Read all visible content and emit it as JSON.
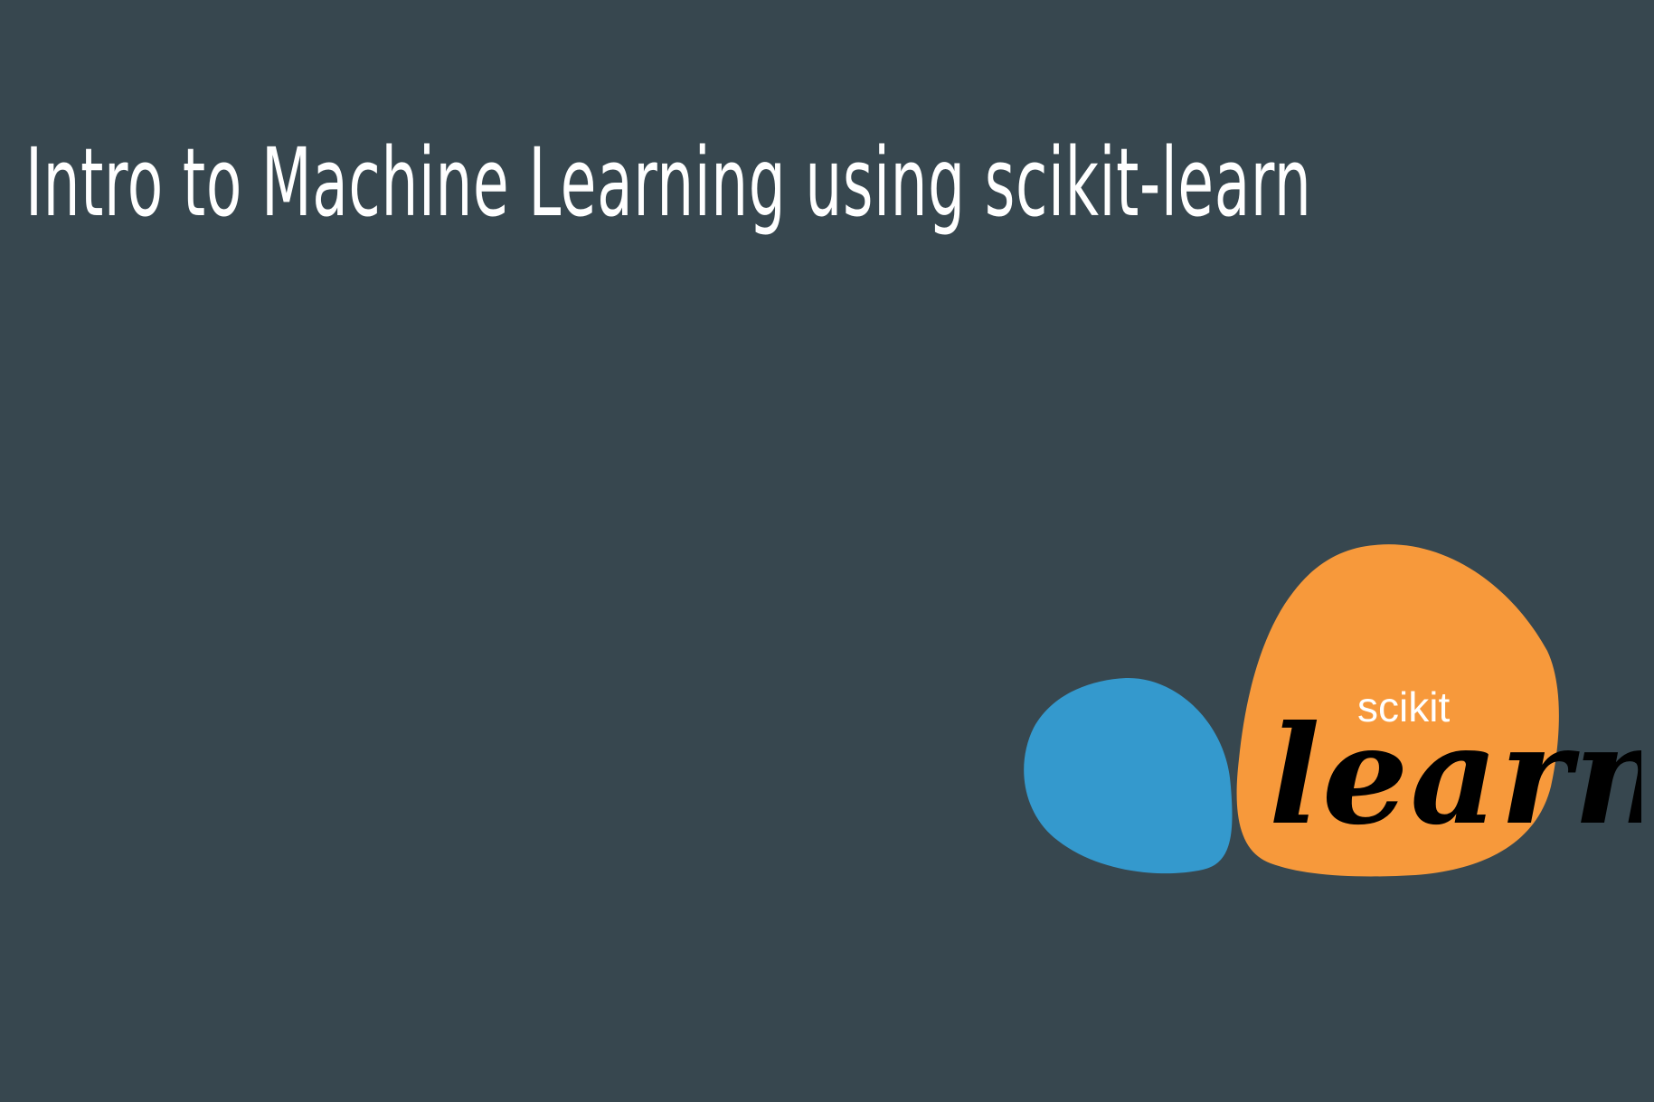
{
  "slide": {
    "title": "Intro to Machine Learning using scikit-learn",
    "background_color": "#37474f"
  },
  "logo": {
    "name": "scikit-learn-logo",
    "text_small": "scikit",
    "text_large": "learn",
    "colors": {
      "blue": "#3499cd",
      "orange": "#f7993b",
      "small_text": "#ffffff",
      "large_text": "#000000"
    }
  }
}
